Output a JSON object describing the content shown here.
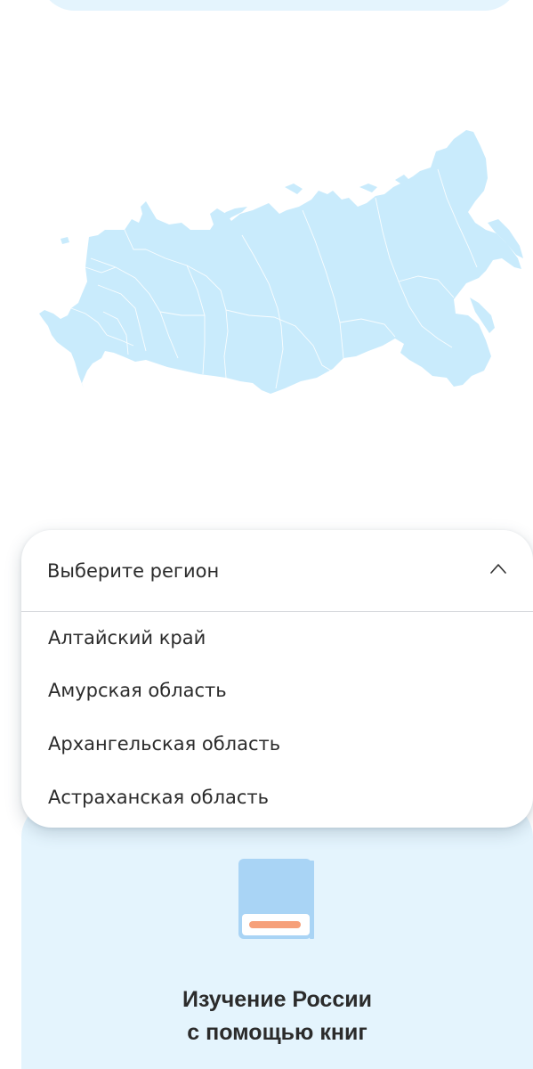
{
  "region_select": {
    "placeholder": "Выберите регион",
    "expanded": true,
    "options": [
      "Алтайский край",
      "Амурская область",
      "Архангельская область",
      "Астраханская область"
    ]
  },
  "map": {
    "fill_color": "#c9ebfc",
    "border_color": "#ffffff"
  },
  "book_card": {
    "title_line1": "Изучение России",
    "title_line2": "с помощью книг",
    "icon": "book-icon",
    "colors": {
      "card_bg": "#e4f4fd",
      "book_cover": "#a9d4f5",
      "book_pages": "#ffffff",
      "book_band": "#f6a07a"
    }
  }
}
